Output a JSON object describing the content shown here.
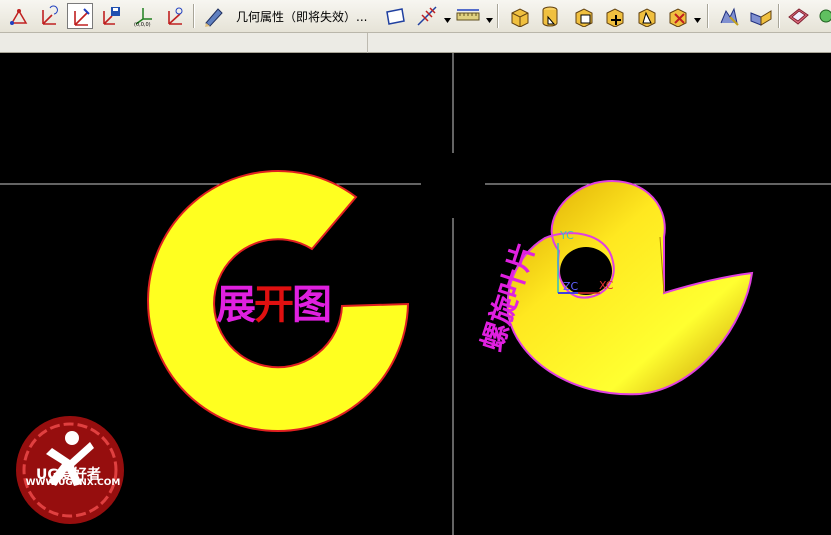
{
  "toolbar": {
    "geometry_properties_label": "几何属性（即将失效）...",
    "buttons": [
      {
        "name": "wcs-dynamics-icon"
      },
      {
        "name": "wcs-origin-icon"
      },
      {
        "name": "wcs-rotate-icon"
      },
      {
        "name": "wcs-save-icon"
      },
      {
        "name": "wcs-absolute-icon"
      },
      {
        "name": "wcs-orient-icon"
      },
      {
        "name": "edit-object-display-icon"
      },
      {
        "name": "sketch-plane-icon"
      },
      {
        "name": "datum-axis-icon"
      },
      {
        "name": "measure-distance-icon"
      },
      {
        "name": "box-icon"
      },
      {
        "name": "cylinder-icon"
      },
      {
        "name": "cone-icon"
      },
      {
        "name": "unite-icon"
      },
      {
        "name": "subtract-icon"
      },
      {
        "name": "intersect-icon"
      },
      {
        "name": "extract-icon"
      },
      {
        "name": "surface-icon"
      },
      {
        "name": "sew-icon"
      },
      {
        "name": "render-icon"
      }
    ]
  },
  "viewport": {
    "left_part_label_1": "展",
    "left_part_label_2": "开",
    "left_part_label_3": "图",
    "right_part_label": "螺旋叶片",
    "axis_yc": "YC",
    "axis_zc": "ZC",
    "axis_xc": "XC",
    "colors": {
      "part_fill": "#ffff20",
      "flat_edge": "#e02020",
      "helix_edge": "#e040e0",
      "label_magenta": "#e020e0"
    }
  },
  "watermark": {
    "brand": "UG爱好者",
    "url": "WWW.UGSNX.COM"
  }
}
